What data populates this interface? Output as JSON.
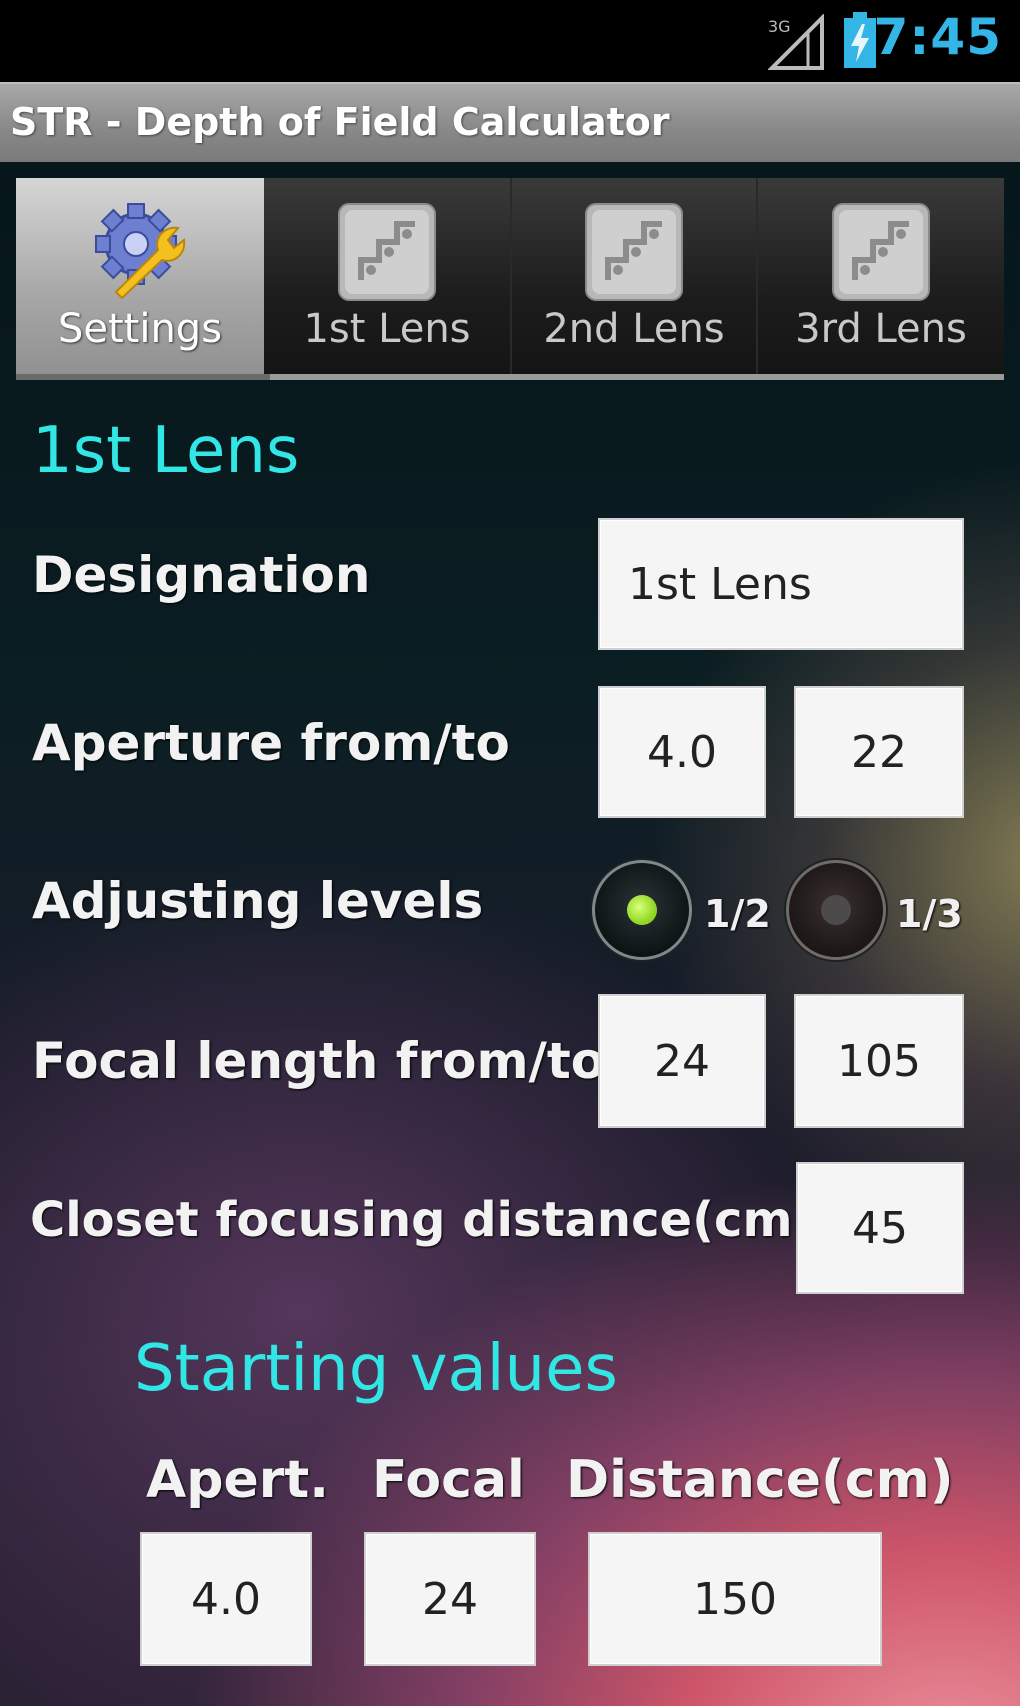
{
  "status_bar": {
    "signal_icon": "signal-3g-icon",
    "battery_icon": "battery-charging-icon",
    "time": "7:45",
    "accent": "#33b5e5"
  },
  "app": {
    "title": "STR - Depth of Field Calculator"
  },
  "tabs": [
    {
      "label": "Settings",
      "icon": "settings-gear-wrench-icon",
      "selected": true
    },
    {
      "label": "1st Lens",
      "icon": "aperture-steps-icon",
      "selected": false
    },
    {
      "label": "2nd Lens",
      "icon": "aperture-steps-icon",
      "selected": false
    },
    {
      "label": "3rd Lens",
      "icon": "aperture-steps-icon",
      "selected": false
    }
  ],
  "section": {
    "heading": "1st Lens",
    "heading_color": "#33e6e6"
  },
  "form": {
    "designation": {
      "label": "Designation",
      "value": "1st Lens"
    },
    "aperture": {
      "label": "Aperture from/to",
      "from": "4.0",
      "to": "22"
    },
    "adjusting": {
      "label": "Adjusting levels",
      "options": [
        {
          "label": "1/2",
          "checked": true
        },
        {
          "label": "1/3",
          "checked": false
        }
      ]
    },
    "focal": {
      "label": "Focal length from/to",
      "from": "24",
      "to": "105"
    },
    "closest": {
      "label": "Closet focusing distance(cm)",
      "value": "45"
    }
  },
  "starting_values": {
    "heading": "Starting values",
    "columns": [
      "Apert.",
      "Focal",
      "Distance(cm)"
    ],
    "values": [
      "4.0",
      "24",
      "150"
    ]
  }
}
